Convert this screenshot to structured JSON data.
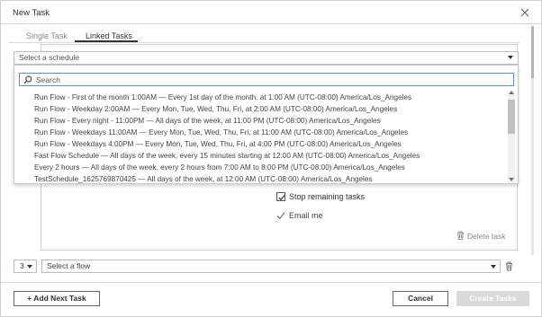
{
  "dialog": {
    "title": "New Task"
  },
  "tabs": [
    {
      "label": "Single Task",
      "active": false
    },
    {
      "label": "Linked Tasks",
      "active": true
    }
  ],
  "schedule_select": {
    "placeholder": "Select a schedule"
  },
  "search": {
    "placeholder": "Search",
    "value": ""
  },
  "schedule_options": [
    "Run Flow - First of the month 1:00AM — Every 1st day of the month, at 1:00 AM (UTC-08:00) America/Los_Angeles",
    "Run Flow - Weekday 2:00AM — Every Mon, Tue, Wed, Thu, Fri, at 2:00 AM (UTC-08:00) America/Los_Angeles",
    "Run Flow - Every night - 11:00PM — All days of the week, at 11:00 PM (UTC-08:00) America/Los_Angeles",
    "Run Flow - Weekdays 11:00AM — Every Mon, Tue, Wed, Thu, Fri, at 11:00 AM (UTC-08:00) America/Los_Angeles",
    "Run Flow - Weekdays 4:00PM — Every Mon, Tue, Wed, Thu, Fri, at 4:00 PM (UTC-08:00) America/Los_Angeles",
    "Fast Flow Schedule — All days of the week, every 15 minutes starting at 12:00 AM (UTC-08:00) America/Los_Angeles",
    "Every 2 hours — All days of the week, every 2 hours from 7:00 AM to 8:00 PM (UTC-08:00) America/Los_Angeles",
    "TestSchedule_1625769870425 — All days of the week, at 12:00 AM (UTC-08:00) America/Los_Angeles"
  ],
  "task_options": {
    "stop_remaining_label": "Stop remaining tasks",
    "stop_remaining_checked": true,
    "email_label": "Email me"
  },
  "delete_task_label": "Delete task",
  "flow_row": {
    "number": "3",
    "flow_placeholder": "Select a flow"
  },
  "footer": {
    "add_next_label": "+ Add Next Task",
    "cancel_label": "Cancel",
    "create_label": "Create Tasks"
  }
}
